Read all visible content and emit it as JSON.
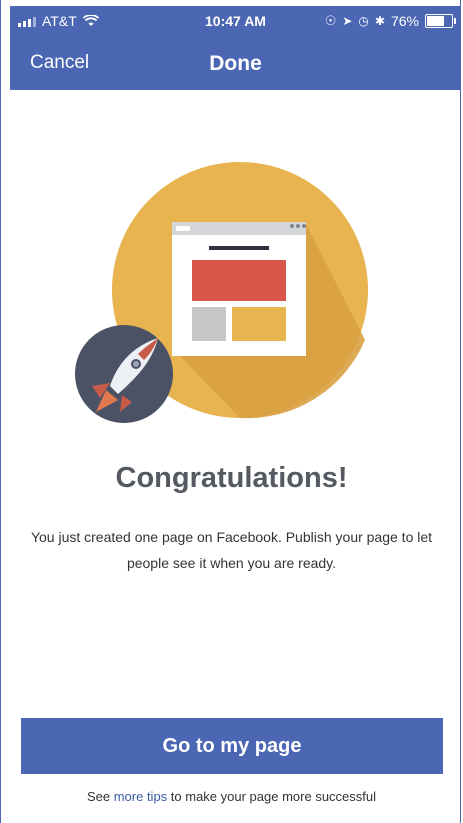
{
  "status_bar": {
    "carrier": "AT&T",
    "time": "10:47 AM",
    "battery_percent": "76%",
    "battery_level": 0.76,
    "icons": [
      "signal-icon",
      "wifi-icon",
      "screen-lock-icon",
      "location-icon",
      "alarm-icon",
      "bluetooth-icon",
      "battery-icon"
    ]
  },
  "nav": {
    "cancel_label": "Cancel",
    "done_label": "Done"
  },
  "content": {
    "title": "Congratulations!",
    "message": "You just created one page on Facebook. Publish your page to let people see it when you are ready."
  },
  "footer": {
    "button_label": "Go to my page",
    "tips_prefix": "See ",
    "tips_link": "more tips",
    "tips_suffix": " to make your page more successful"
  },
  "colors": {
    "brand_blue": "#4b66b3",
    "circle_gold": "#e7b44f",
    "red_block": "#d8574a",
    "rocket_bg": "#4c5266"
  }
}
